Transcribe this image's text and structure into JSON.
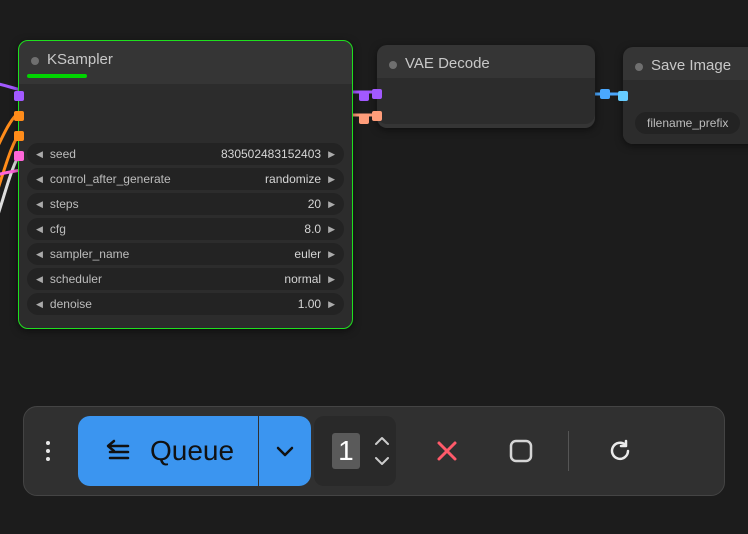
{
  "nodes": {
    "ksampler": {
      "title": "KSampler",
      "params": {
        "seed": {
          "label": "seed",
          "value": "830502483152403"
        },
        "control_after_generate": {
          "label": "control_after_generate",
          "value": "randomize"
        },
        "steps": {
          "label": "steps",
          "value": "20"
        },
        "cfg": {
          "label": "cfg",
          "value": "8.0"
        },
        "sampler_name": {
          "label": "sampler_name",
          "value": "euler"
        },
        "scheduler": {
          "label": "scheduler",
          "value": "normal"
        },
        "denoise": {
          "label": "denoise",
          "value": "1.00"
        }
      }
    },
    "vae_decode": {
      "title": "VAE Decode"
    },
    "save_image": {
      "title": "Save Image",
      "params": {
        "filename_prefix": {
          "label": "filename_prefix"
        }
      }
    }
  },
  "toolbar": {
    "queue_label": "Queue",
    "batch_count": "1"
  },
  "colors": {
    "accent_blue": "#3b95f0",
    "node_selected": "#1ee01e"
  }
}
